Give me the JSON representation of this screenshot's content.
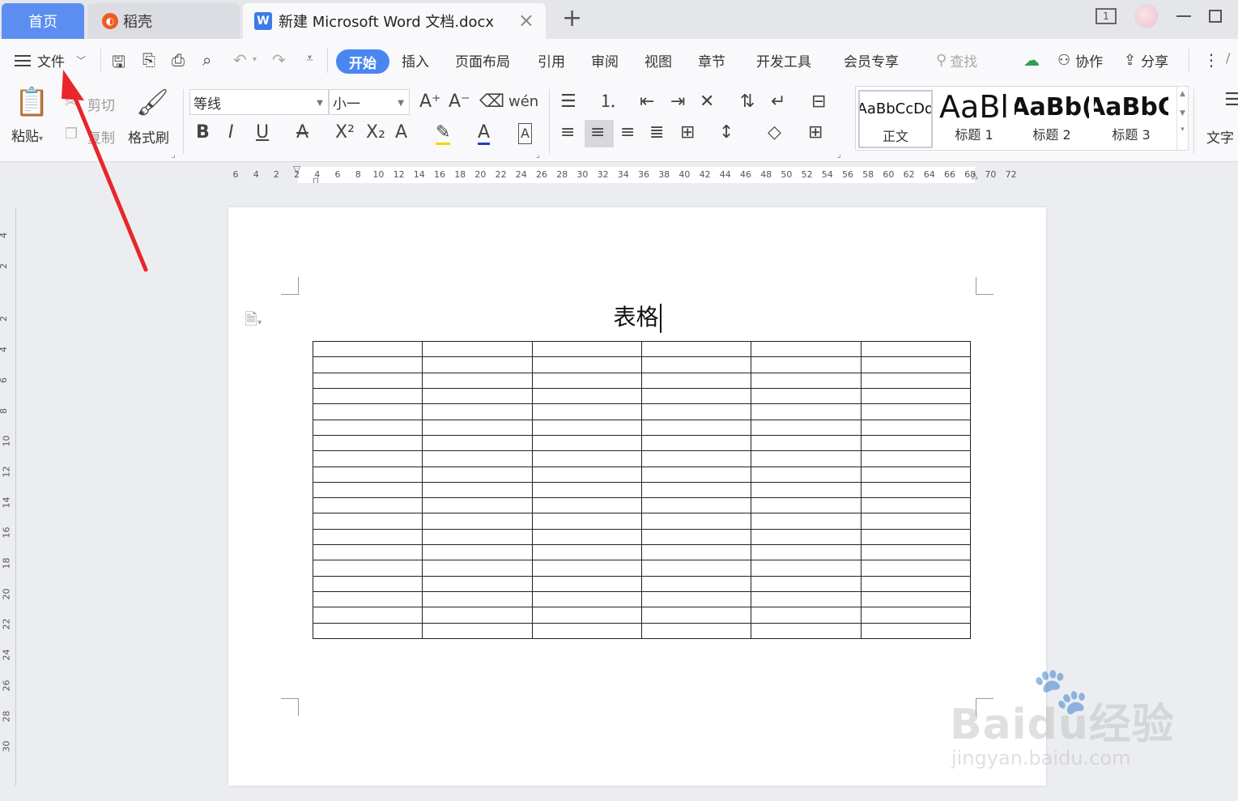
{
  "tabs": {
    "home": "首页",
    "daoke": "稻壳",
    "document": "新建 Microsoft Word 文档.docx",
    "close_symbol": "×",
    "new_tab_symbol": "+"
  },
  "window": {
    "page_badge": "1"
  },
  "menubar": {
    "file": "文件",
    "items": [
      "开始",
      "插入",
      "页面布局",
      "引用",
      "审阅",
      "视图",
      "章节",
      "开发工具",
      "会员专享"
    ],
    "search_placeholder": "查找",
    "collab": "协作",
    "share": "分享"
  },
  "ribbon": {
    "paste": "粘贴",
    "cut": "剪切",
    "copy": "复制",
    "format_painter": "格式刷",
    "font_name": "等线",
    "font_size": "小一",
    "styles": [
      {
        "sample": "AaBbCcDd",
        "label": "正文"
      },
      {
        "sample": "AaBl",
        "label": "标题 1"
      },
      {
        "sample": "AaBb(",
        "label": "标题 2"
      },
      {
        "sample": "AaBbC",
        "label": "标题 3"
      }
    ],
    "text_tools": "文字"
  },
  "ruler": {
    "h_ticks": [
      "6",
      "4",
      "2",
      "2",
      "4",
      "6",
      "8",
      "10",
      "12",
      "14",
      "16",
      "18",
      "20",
      "22",
      "24",
      "26",
      "28",
      "30",
      "32",
      "34",
      "36",
      "38",
      "40",
      "42",
      "44",
      "46",
      "48",
      "50",
      "52",
      "54",
      "56",
      "58",
      "60",
      "62",
      "64",
      "66",
      "68",
      "70",
      "72"
    ],
    "v_ticks": [
      "4",
      "2",
      "2",
      "4",
      "6",
      "8",
      "10",
      "12",
      "14",
      "16",
      "18",
      "20",
      "22",
      "24",
      "26",
      "28",
      "30"
    ]
  },
  "document": {
    "title": "表格",
    "table": {
      "rows": 19,
      "cols": 6
    }
  },
  "watermark": {
    "main": "Baidu经验",
    "sub": "jingyan.baidu.com"
  },
  "colors": {
    "accent": "#4a86f0",
    "arrow": "#e8262b"
  }
}
